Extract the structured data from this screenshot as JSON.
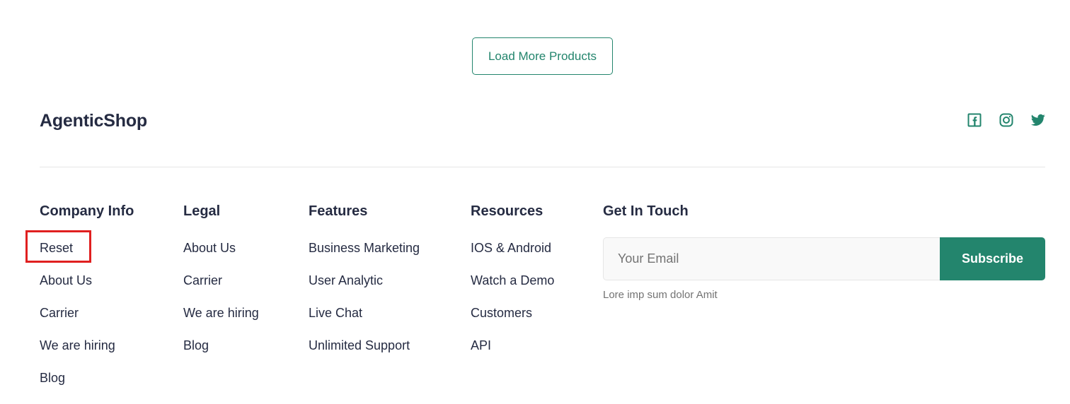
{
  "load_more": {
    "label": "Load More Products"
  },
  "brand": {
    "name": "AgenticShop"
  },
  "socials": [
    {
      "icon": "facebook-icon"
    },
    {
      "icon": "instagram-icon"
    },
    {
      "icon": "twitter-icon"
    }
  ],
  "columns": {
    "company": {
      "title": "Company Info",
      "items": [
        "Reset",
        "About Us",
        "Carrier",
        "We are hiring",
        "Blog"
      ]
    },
    "legal": {
      "title": "Legal",
      "items": [
        "About Us",
        "Carrier",
        "We are hiring",
        "Blog"
      ]
    },
    "features": {
      "title": "Features",
      "items": [
        "Business Marketing",
        "User Analytic",
        "Live Chat",
        "Unlimited Support"
      ]
    },
    "resources": {
      "title": "Resources",
      "items": [
        "IOS & Android",
        "Watch a Demo",
        "Customers",
        "API"
      ]
    }
  },
  "contact": {
    "title": "Get In Touch",
    "email_placeholder": "Your Email",
    "subscribe_label": "Subscribe",
    "note": "Lore imp sum dolor Amit"
  },
  "colors": {
    "accent": "#23856d",
    "text_dark": "#252b42",
    "text_muted": "#737373",
    "highlight": "#e02020"
  }
}
